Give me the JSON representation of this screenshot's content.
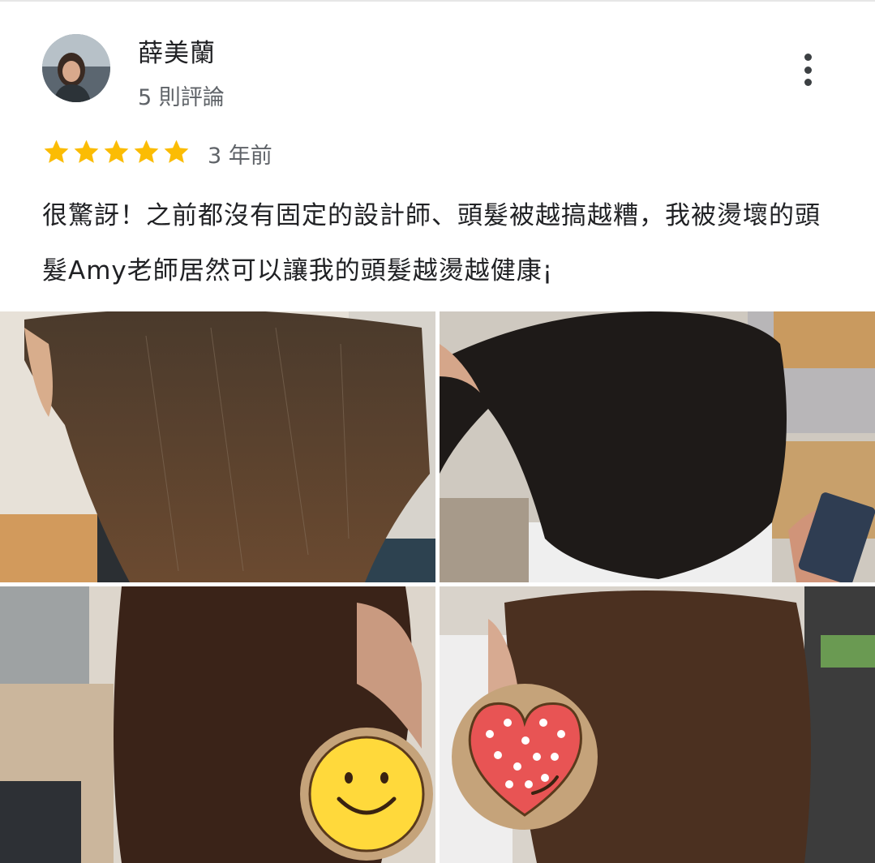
{
  "reviewer": {
    "name": "薛美蘭",
    "review_count": "5 則評論",
    "avatar_icon": "profile-photo"
  },
  "rating": {
    "stars": 5,
    "max": 5,
    "star_color": "#fbbc04"
  },
  "time_ago": "3 年前",
  "review": {
    "text": "很驚訝！之前都沒有固定的設計師、頭髮被越搞越糟，我被燙壞的頭髮Amy老師居然可以讓我的頭髮越燙越健康¡"
  },
  "menu_icon": "more-vert-icon",
  "photos": [
    {
      "icon": "hair-photo"
    },
    {
      "icon": "hair-photo"
    },
    {
      "icon": "hair-photo"
    },
    {
      "icon": "hair-photo"
    }
  ]
}
